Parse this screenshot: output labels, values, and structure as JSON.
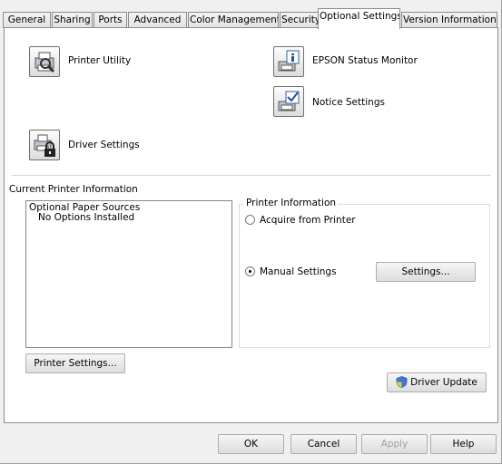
{
  "tabs": [
    {
      "label": "General"
    },
    {
      "label": "Sharing"
    },
    {
      "label": "Ports"
    },
    {
      "label": "Advanced"
    },
    {
      "label": "Color Management"
    },
    {
      "label": "Security"
    },
    {
      "label": "Optional Settings"
    },
    {
      "label": "Version Information"
    }
  ],
  "active_tab": "Optional Settings",
  "utilities": {
    "printer_utility": "Printer Utility",
    "status_monitor": "EPSON Status Monitor",
    "notice_settings": "Notice Settings",
    "driver_settings": "Driver Settings"
  },
  "current_info": {
    "label": "Current Printer Information",
    "list": [
      "Optional Paper Sources",
      "No Options Installed"
    ]
  },
  "printer_information": {
    "title": "Printer Information",
    "acquire_label": "Acquire from Printer",
    "manual_label": "Manual Settings",
    "selected": "Manual Settings",
    "settings_button": "Settings..."
  },
  "printer_settings_button": "Printer Settings...",
  "driver_update_button": "Driver Update",
  "footer": {
    "ok": "OK",
    "cancel": "Cancel",
    "apply": "Apply",
    "help": "Help"
  }
}
